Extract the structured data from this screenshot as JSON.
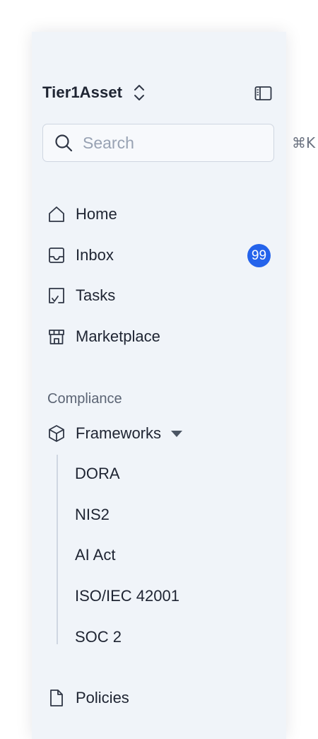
{
  "workspace": {
    "name": "Tier1Asset"
  },
  "search": {
    "placeholder": "Search",
    "shortcut": "⌘K"
  },
  "nav": {
    "items": [
      {
        "label": "Home",
        "icon": "home-icon"
      },
      {
        "label": "Inbox",
        "icon": "inbox-icon",
        "badge": "99"
      },
      {
        "label": "Tasks",
        "icon": "tasks-icon"
      },
      {
        "label": "Marketplace",
        "icon": "store-icon"
      }
    ]
  },
  "compliance": {
    "section_label": "Compliance",
    "frameworks_label": "Frameworks",
    "frameworks": [
      "DORA",
      "NIS2",
      "AI Act",
      "ISO/IEC 42001",
      "SOC 2"
    ],
    "policies_label": "Policies"
  },
  "colors": {
    "sidebar_bg": "#f0f4f9",
    "text": "#1e2432",
    "muted": "#5b6474",
    "badge": "#2463eb"
  }
}
